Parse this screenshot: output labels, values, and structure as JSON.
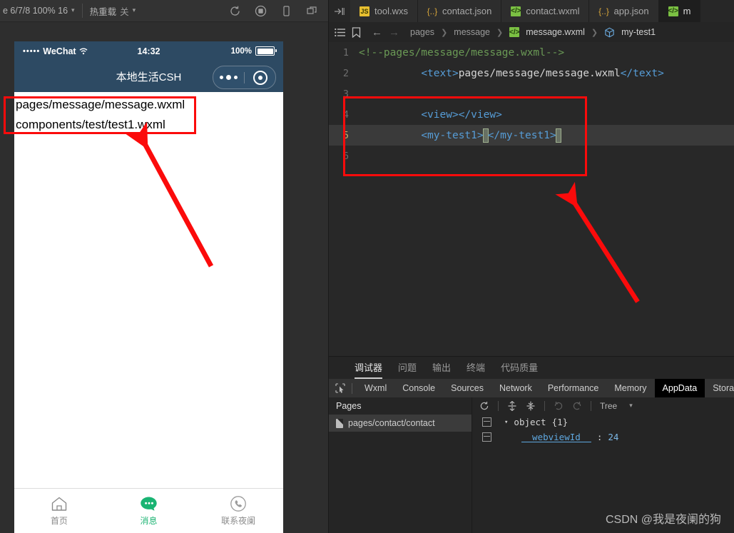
{
  "simulator": {
    "toolbar": {
      "device_label": "e 6/7/8 100% 16",
      "hot_reload_label": "热重载",
      "hot_reload_value": "关",
      "icons": [
        "refresh-icon",
        "record-icon",
        "device-icon",
        "multi-window-icon"
      ]
    },
    "status_bar": {
      "carrier_dots": "•••••",
      "carrier": "WeChat",
      "wifi": "≋",
      "time": "14:32",
      "battery_percent": "100%"
    },
    "nav_title": "本地生活CSH",
    "page_lines": [
      "pages/message/message.wxml",
      "components/test/test1.wxml"
    ],
    "tab_bar": [
      {
        "icon": "home-icon",
        "label": "首页",
        "active": false
      },
      {
        "icon": "message-bubble-icon",
        "label": "消息",
        "active": true
      },
      {
        "icon": "phone-icon",
        "label": "联系夜阑",
        "active": false
      }
    ]
  },
  "ide": {
    "editor_tabs": [
      {
        "label": "tool.wxs",
        "icon": "js-file-icon",
        "kind": "js",
        "active": false
      },
      {
        "label": "contact.json",
        "icon": "json-file-icon",
        "kind": "json",
        "active": false
      },
      {
        "label": "contact.wxml",
        "icon": "wxml-file-icon",
        "kind": "wxml",
        "active": false
      },
      {
        "label": "app.json",
        "icon": "json-file-icon",
        "kind": "json",
        "active": false
      },
      {
        "label": "m",
        "icon": "wxml-file-icon",
        "kind": "wxml",
        "active": true
      }
    ],
    "breadcrumb": {
      "list_icon": "list-icon",
      "bookmark_icon": "bookmark-icon",
      "back_icon": "arrow-left-icon",
      "forward_icon": "arrow-right-icon",
      "items": [
        "pages",
        "message",
        "message.wxml",
        "my-test1"
      ],
      "file_icon": "wxml-file-icon",
      "component_icon": "component-cube-icon"
    },
    "code": {
      "lines": [
        {
          "num": "1",
          "kind": "comment",
          "text": "<!--pages/message/message.wxml-->"
        },
        {
          "num": "2",
          "kind": "text-tag",
          "open": "<text>",
          "body": "pages/message/message.wxml",
          "close": "</text>"
        },
        {
          "num": "3",
          "kind": "blank",
          "text": ""
        },
        {
          "num": "4",
          "kind": "tag-pair",
          "open": "<view>",
          "close": "</view>"
        },
        {
          "num": "5",
          "kind": "tag-pair-caret",
          "open": "<my-test1>",
          "close": "</my-test1>",
          "highlighted": true
        },
        {
          "num": "6",
          "kind": "blank",
          "text": ""
        }
      ]
    },
    "panel_tabs": [
      {
        "label": "调试器",
        "active": true
      },
      {
        "label": "问题",
        "active": false
      },
      {
        "label": "输出",
        "active": false
      },
      {
        "label": "终端",
        "active": false
      },
      {
        "label": "代码质量",
        "active": false
      }
    ],
    "devtools_tabs": [
      {
        "label": "Wxml",
        "active": false
      },
      {
        "label": "Console",
        "active": false
      },
      {
        "label": "Sources",
        "active": false
      },
      {
        "label": "Network",
        "active": false
      },
      {
        "label": "Performance",
        "active": false
      },
      {
        "label": "Memory",
        "active": false
      },
      {
        "label": "AppData",
        "active": true
      },
      {
        "label": "Storag",
        "active": false
      }
    ],
    "appdata": {
      "pages_header": "Pages",
      "pages": [
        "pages/contact/contact"
      ],
      "toolbar": {
        "refresh_icon": "refresh-icon",
        "expand_icon": "expand-all-icon",
        "collapse_icon": "collapse-all-icon",
        "undo_icon": "undo-icon",
        "redo_icon": "redo-icon",
        "view_mode": "Tree"
      },
      "rows": [
        {
          "indent": 0,
          "expander": "▾",
          "label": "object",
          "value": "{1}",
          "type": "object"
        },
        {
          "indent": 1,
          "expander": "",
          "label": "__webviewId__",
          "value": "24",
          "type": "number"
        }
      ]
    }
  },
  "watermark": "CSDN @我是夜阑的狗",
  "colors": {
    "annotation_red": "#fb0b0b",
    "phone_header": "#2d4a63",
    "tab_active_green": "#21b576",
    "editor_bg": "#282828"
  }
}
